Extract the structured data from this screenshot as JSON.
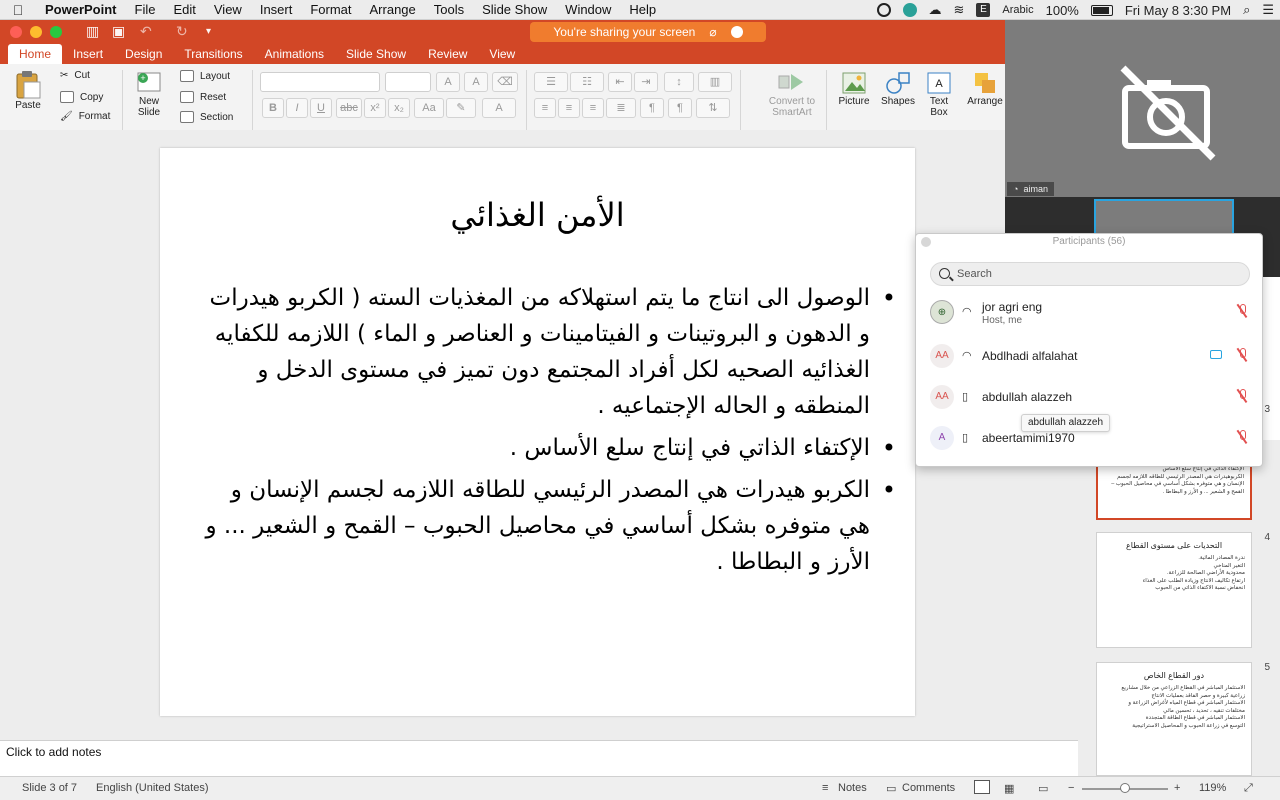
{
  "menubar": {
    "app_name": "PowerPoint",
    "items": [
      "File",
      "Edit",
      "View",
      "Insert",
      "Format",
      "Arrange",
      "Tools",
      "Slide Show",
      "Window",
      "Help"
    ],
    "input_source": "Arabic",
    "battery": "100%",
    "datetime": "Fri May 8  3:30 PM"
  },
  "titlebar": {
    "sharing_text": "You're sharing your screen"
  },
  "tabs": [
    "Home",
    "Insert",
    "Design",
    "Transitions",
    "Animations",
    "Slide Show",
    "Review",
    "View"
  ],
  "ribbon": {
    "paste": "Paste",
    "cut": "Cut",
    "copy": "Copy",
    "format": "Format",
    "new_slide_1": "New",
    "new_slide_2": "Slide",
    "layout": "Layout",
    "reset": "Reset",
    "section": "Section",
    "convert_1": "Convert to",
    "convert_2": "SmartArt",
    "picture": "Picture",
    "shapes": "Shapes",
    "text_box_1": "Text",
    "text_box_2": "Box",
    "arrange": "Arrange"
  },
  "slide": {
    "title": "الأمن الغذائي",
    "bullets": [
      "الوصول الى انتاج ما يتم استهلاكه من المغذيات السته ( الكربو هيدرات و الدهون و البروتينات و الفيتامينات و العناصر و الماء ) اللازمه للكفايه الغذائيه الصحيه لكل أفراد المجتمع دون تميز في مستوى الدخل و المنطقه و الحاله الإجتماعيه .",
      "الإكتفاء الذاتي في إنتاج سلع الأساس .",
      "الكربو هيدرات هي المصدر الرئيسي للطاقه اللازمه لجسم الإنسان و هي متوفره بشكل أساسي في محاصيل الحبوب – القمح و الشعير ... و الأرز و البطاطا ."
    ]
  },
  "notes": {
    "placeholder": "Click to add notes"
  },
  "statusbar": {
    "slide_info": "Slide 3 of 7",
    "language": "English (United States)",
    "notes": "Notes",
    "comments": "Comments",
    "zoom": "119%"
  },
  "thumbnails": [
    {
      "number": "3",
      "lines": [
        "الإكتفاء الذاتي في إنتاج سلع الأساس",
        "الكربوهيدرات هي المصدر الرئيسي للطاقه اللازمه لجسم",
        "الإنسان و هي متوفره بشكل أساسي في محاصيل الحبوب –",
        "القمح و الشعير ... و الأرز و البطاطا ."
      ]
    },
    {
      "number": "4",
      "title": "التحديات على مستوى القطاع",
      "lines": [
        "ندرة المصادر المائية.",
        "التغير المناخي",
        "محدودية الأراضي الصالحة للزراعة.",
        "ارتفاع تكاليف الانتاج وزيادة الطلب على الغذاء",
        "انخفاض نسبة الاكتفاء الذاتي من الحبوب"
      ]
    },
    {
      "number": "5",
      "title": "دور القطاع الخاص",
      "lines": [
        "الاستثمار المباشر في القطاع الزراعي من خلال مشاريع",
        "زراعية كبيرة و حصر الفاقد بعمليات الانتاج",
        "الاستثمار المباشر في قطاع المياه لأغراض الزراعة و",
        "مختلفات تنقيه ، تحديد ، تحسين مائي",
        "الاستثمار المباشر في قطاع الطاقة المتجددة",
        "التوسع في زراعة الحبوب و المحاصيل الاستراتيجية"
      ]
    }
  ],
  "video": {
    "speaker_label": "aiman"
  },
  "participants": {
    "title": "Participants (56)",
    "search_placeholder": "Search",
    "list": [
      {
        "initials": "",
        "name": "jor agri eng",
        "sub": "Host, me"
      },
      {
        "initials": "AA",
        "name": "Abdlhadi alfalahat",
        "sub": ""
      },
      {
        "initials": "AA",
        "name": "abdullah alazzeh",
        "sub": ""
      },
      {
        "initials": "A",
        "name": "abeertamimi1970",
        "sub": ""
      }
    ],
    "tooltip": "abdullah alazzeh"
  }
}
